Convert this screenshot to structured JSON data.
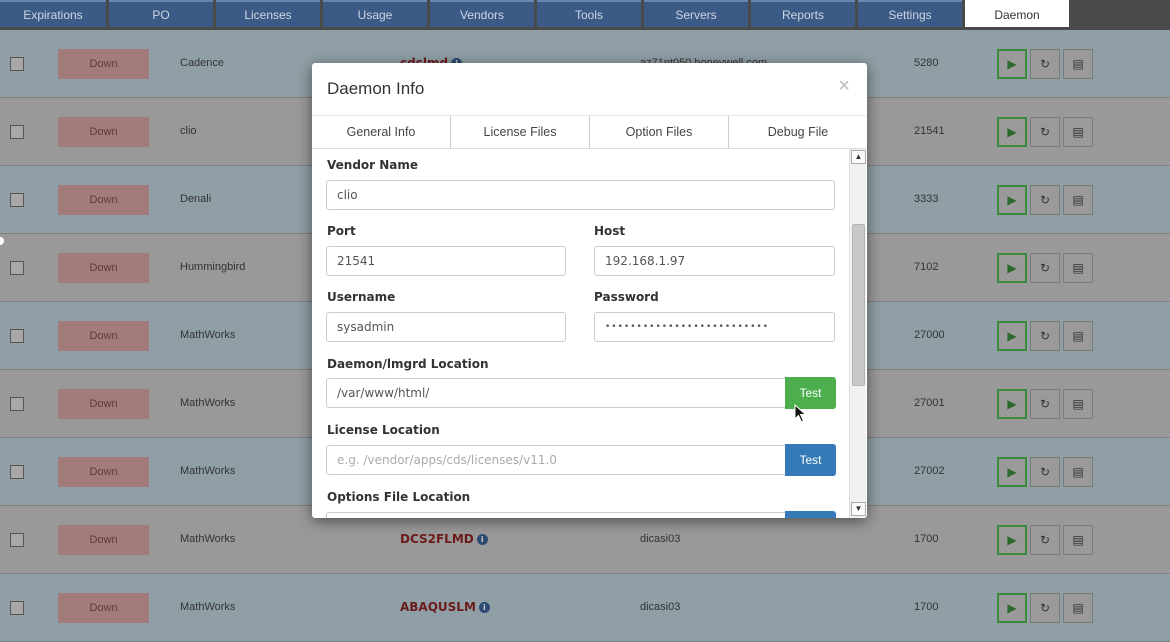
{
  "nav": {
    "tabs": [
      "Expirations",
      "PO",
      "Licenses",
      "Usage",
      "Vendors",
      "Tools",
      "Servers",
      "Reports",
      "Settings",
      "Daemon"
    ],
    "active": "Daemon"
  },
  "rows": [
    {
      "status": "Down",
      "vendor": "Cadence",
      "daemon": "cdslmd",
      "host": "az71nt050.honeywell.com",
      "port": "5280"
    },
    {
      "status": "Down",
      "vendor": "clio",
      "daemon": "",
      "host": "",
      "port": "21541"
    },
    {
      "status": "Down",
      "vendor": "Denali",
      "daemon": "",
      "host": "",
      "port": "3333"
    },
    {
      "status": "Down",
      "vendor": "Hummingbird",
      "daemon": "",
      "host": "",
      "port": "7102"
    },
    {
      "status": "Down",
      "vendor": "MathWorks",
      "daemon": "",
      "host": "",
      "port": "27000"
    },
    {
      "status": "Down",
      "vendor": "MathWorks",
      "daemon": "",
      "host": "",
      "port": "27001"
    },
    {
      "status": "Down",
      "vendor": "MathWorks",
      "daemon": "",
      "host": "",
      "port": "27002"
    },
    {
      "status": "Down",
      "vendor": "MathWorks",
      "daemon": "DCS2FLMD",
      "host": "dicasi03",
      "port": "1700"
    },
    {
      "status": "Down",
      "vendor": "MathWorks",
      "daemon": "ABAQUSLM",
      "host": "dicasi03",
      "port": "1700"
    }
  ],
  "row_actions": {
    "start_icon": "play-icon",
    "restart_icon": "refresh-icon",
    "log_icon": "list-icon"
  },
  "modal": {
    "title": "Daemon Info",
    "close": "×",
    "tabs": [
      "General Info",
      "License Files",
      "Option Files",
      "Debug File"
    ],
    "fields": {
      "vendor_name_label": "Vendor Name",
      "vendor_name_value": "clio",
      "port_label": "Port",
      "port_value": "21541",
      "host_label": "Host",
      "host_value": "192.168.1.97",
      "username_label": "Username",
      "username_value": "sysadmin",
      "password_label": "Password",
      "password_value": "••••••••••••••••••••••••••",
      "daemon_location_label": "Daemon/lmgrd Location",
      "daemon_location_value": "/var/www/html/",
      "license_location_label": "License Location",
      "license_location_placeholder": "e.g. /vendor/apps/cds/licenses/v11.0",
      "options_location_label": "Options File Location"
    },
    "test_label": "Test"
  },
  "colors": {
    "nav_tab": "#3b5a86",
    "test_green": "#4cae4c",
    "test_blue": "#337ab7",
    "status_down": "#a27c7b"
  }
}
